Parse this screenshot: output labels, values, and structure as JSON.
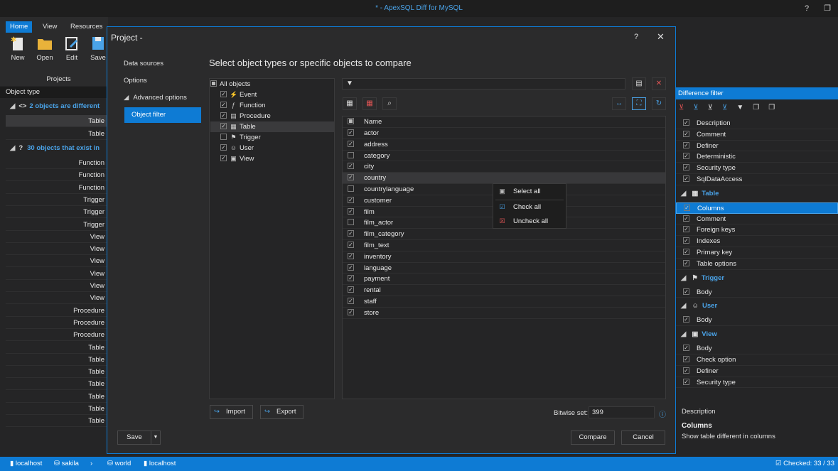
{
  "app": {
    "title": "* - ApexSQL Diff for MySQL",
    "help": "?",
    "restore": "❐"
  },
  "ribbon": {
    "tabs": [
      {
        "label": "Home"
      },
      {
        "label": "View"
      },
      {
        "label": "Resources"
      }
    ],
    "buttons": [
      {
        "label": "New"
      },
      {
        "label": "Open"
      },
      {
        "label": "Edit"
      },
      {
        "label": "Save"
      }
    ],
    "group_label": "Projects"
  },
  "left_grid": {
    "header": "Object type",
    "group1": "2 objects are different",
    "group2": "30 objects that exist in",
    "rows1": [
      "Table",
      "Table"
    ],
    "rows2": [
      "Function",
      "Function",
      "Function",
      "Trigger",
      "Trigger",
      "Trigger",
      "View",
      "View",
      "View",
      "View",
      "View",
      "View",
      "Procedure",
      "Procedure",
      "Procedure",
      "Table",
      "Table",
      "Table",
      "Table",
      "Table",
      "Table",
      "Table"
    ]
  },
  "dialog": {
    "title": "Project  -",
    "help": "?",
    "close": "✕",
    "nav": {
      "data_sources": "Data sources",
      "options": "Options",
      "advanced": "Advanced options",
      "object_filter": "Object filter"
    },
    "heading": "Select object types or specific objects  to compare",
    "tree": {
      "root": "All objects",
      "items": [
        {
          "label": "Event",
          "checked": true,
          "icon": "event-icon"
        },
        {
          "label": "Function",
          "checked": true,
          "icon": "function-icon"
        },
        {
          "label": "Procedure",
          "checked": true,
          "icon": "procedure-icon"
        },
        {
          "label": "Table",
          "checked": true,
          "icon": "table-icon"
        },
        {
          "label": "Trigger",
          "checked": false,
          "icon": "trigger-icon"
        },
        {
          "label": "User",
          "checked": true,
          "icon": "user-icon"
        },
        {
          "label": "View",
          "checked": true,
          "icon": "view-icon"
        }
      ]
    },
    "list": {
      "column": "Name",
      "items": [
        {
          "name": "actor",
          "checked": true
        },
        {
          "name": "address",
          "checked": true
        },
        {
          "name": "category",
          "checked": false
        },
        {
          "name": "city",
          "checked": true
        },
        {
          "name": "country",
          "checked": true
        },
        {
          "name": "countrylanguage",
          "checked": false
        },
        {
          "name": "customer",
          "checked": true
        },
        {
          "name": "film",
          "checked": true
        },
        {
          "name": "film_actor",
          "checked": false
        },
        {
          "name": "film_category",
          "checked": true
        },
        {
          "name": "film_text",
          "checked": true
        },
        {
          "name": "inventory",
          "checked": true
        },
        {
          "name": "language",
          "checked": true
        },
        {
          "name": "payment",
          "checked": true
        },
        {
          "name": "rental",
          "checked": true
        },
        {
          "name": "staff",
          "checked": true
        },
        {
          "name": "store",
          "checked": true
        }
      ]
    },
    "context_menu": {
      "select_all": "Select all",
      "check_all": "Check all",
      "uncheck_all": "Uncheck all"
    },
    "import": "Import",
    "export": "Export",
    "bitwise_label": "Bitwise set:",
    "bitwise_value": "399",
    "save": "Save",
    "compare": "Compare",
    "cancel": "Cancel"
  },
  "diff_filter": {
    "header": "Difference filter",
    "top": [
      "Description",
      "Comment",
      "Definer",
      "Deterministic",
      "Security type",
      "SqlDataAccess"
    ],
    "table_group": "Table",
    "table": [
      "Columns",
      "Comment",
      "Foreign keys",
      "Indexes",
      "Primary key",
      "Table options"
    ],
    "trigger_group": "Trigger",
    "trigger": [
      "Body"
    ],
    "user_group": "User",
    "user": [
      "Body"
    ],
    "view_group": "View",
    "view": [
      "Body",
      "Check option",
      "Definer",
      "Security type"
    ],
    "desc_label": "Description",
    "desc_title": "Columns",
    "desc_text": "Show table different in columns"
  },
  "status": {
    "server1": "localhost",
    "db": "sakila",
    "db2": "world",
    "server2": "localhost",
    "checked": "Checked: 33 / 33"
  },
  "colors": {
    "accent": "#0e7bd4",
    "bg": "#252526",
    "panel": "#2b2b2c"
  }
}
